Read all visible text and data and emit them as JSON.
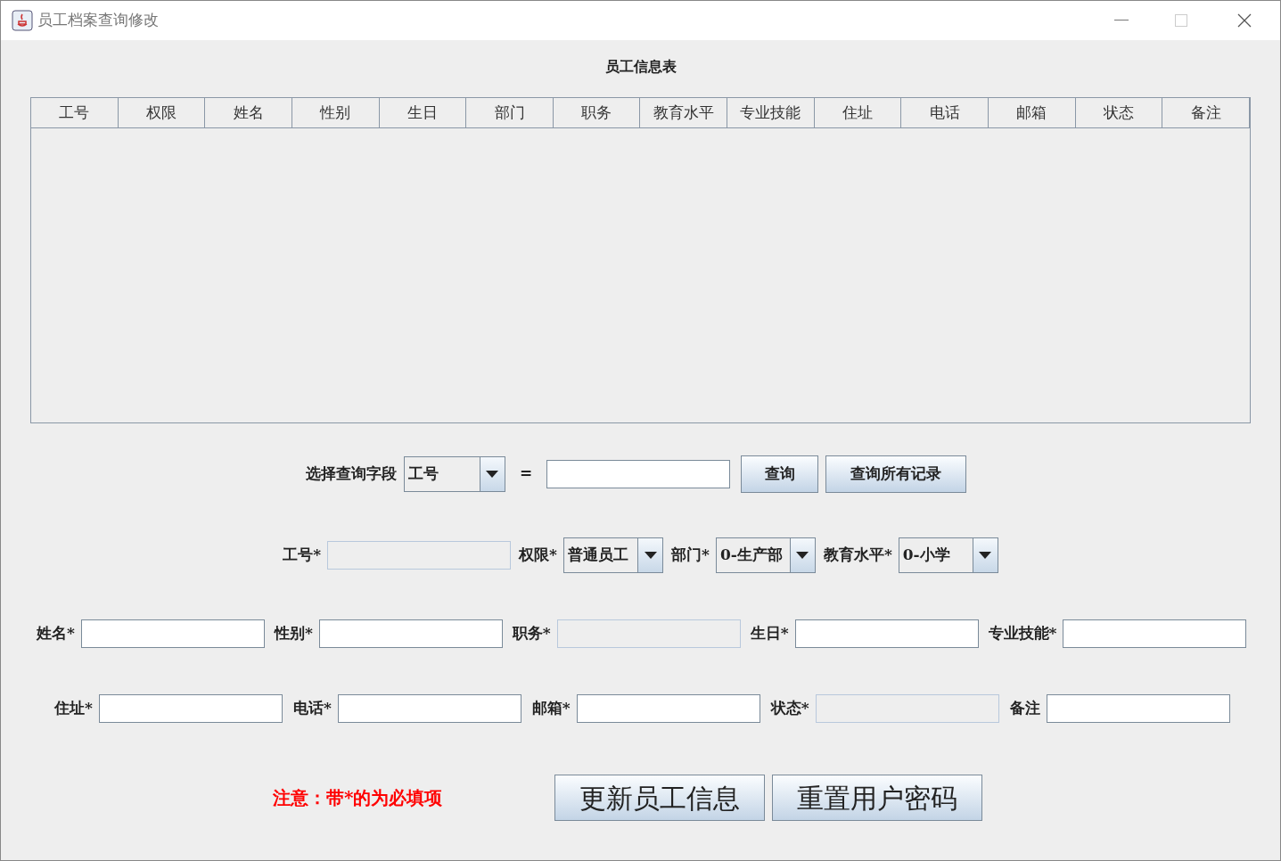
{
  "window": {
    "title": "员工档案查询修改"
  },
  "table": {
    "title": "员工信息表",
    "columns": [
      "工号",
      "权限",
      "姓名",
      "性别",
      "生日",
      "部门",
      "职务",
      "教育水平",
      "专业技能",
      "住址",
      "电话",
      "邮箱",
      "状态",
      "备注"
    ]
  },
  "query": {
    "label": "选择查询字段",
    "field": "工号",
    "equals": "=",
    "buttons": [
      "查询",
      "查询所有记录"
    ]
  },
  "account_fields": [
    {
      "label": "工号*",
      "kind": "text",
      "disabled": true
    },
    {
      "label": "权限*",
      "kind": "select",
      "value": "普通员工"
    },
    {
      "label": "部门*",
      "kind": "select",
      "value": "0-生产部"
    },
    {
      "label": "教育水平*",
      "kind": "select",
      "value": "0-小学"
    }
  ],
  "personal_fields": [
    {
      "label": "姓名*",
      "kind": "text",
      "disabled": false
    },
    {
      "label": "性别*",
      "kind": "text",
      "disabled": false
    },
    {
      "label": "职务*",
      "kind": "text",
      "disabled": true
    },
    {
      "label": "生日*",
      "kind": "text",
      "disabled": false
    },
    {
      "label": "专业技能*",
      "kind": "text",
      "disabled": false
    }
  ],
  "contact_fields": [
    {
      "label": "住址*",
      "kind": "text",
      "disabled": false
    },
    {
      "label": "电话*",
      "kind": "text",
      "disabled": false
    },
    {
      "label": "邮箱*",
      "kind": "text",
      "disabled": false
    },
    {
      "label": "状态*",
      "kind": "text",
      "disabled": true
    },
    {
      "label": "备注",
      "kind": "text",
      "disabled": false
    }
  ],
  "note": "注意：带*的为必填项",
  "actions": [
    "更新员工信息",
    "重置用户密码"
  ]
}
